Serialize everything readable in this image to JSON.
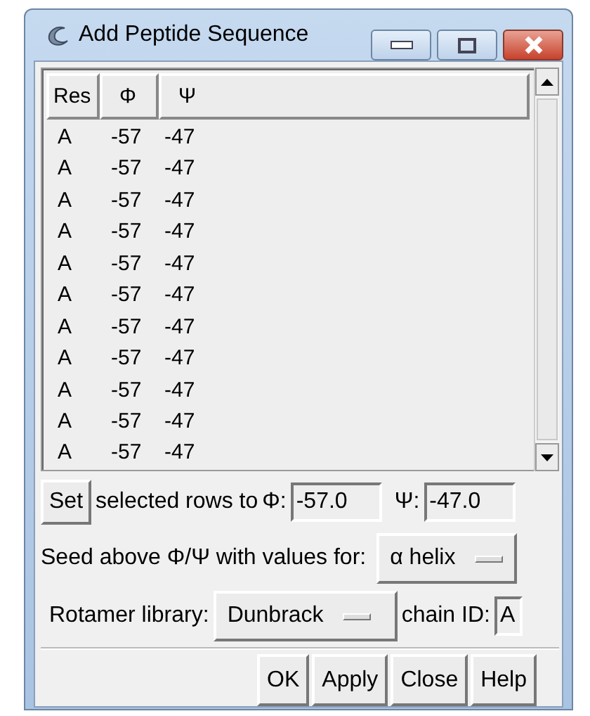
{
  "window": {
    "title": "Add Peptide Sequence"
  },
  "table": {
    "columns": [
      "Res",
      "Φ",
      "Ψ"
    ],
    "rows": [
      {
        "cells": [
          "A",
          "-57",
          "-47"
        ]
      },
      {
        "cells": [
          "A",
          "-57",
          "-47"
        ]
      },
      {
        "cells": [
          "A",
          "-57",
          "-47"
        ]
      },
      {
        "cells": [
          "A",
          "-57",
          "-47"
        ]
      },
      {
        "cells": [
          "A",
          "-57",
          "-47"
        ]
      },
      {
        "cells": [
          "A",
          "-57",
          "-47"
        ]
      },
      {
        "cells": [
          "A",
          "-57",
          "-47"
        ]
      },
      {
        "cells": [
          "A",
          "-57",
          "-47"
        ]
      },
      {
        "cells": [
          "A",
          "-57",
          "-47"
        ]
      },
      {
        "cells": [
          "A",
          "-57",
          "-47"
        ]
      },
      {
        "cells": [
          "A",
          "-57",
          "-47"
        ]
      }
    ]
  },
  "set_row": {
    "button": "Set",
    "label": "selected rows to",
    "phi_label": "Φ:",
    "phi_value": "-57.0",
    "psi_label": "Ψ:",
    "psi_value": "-47.0"
  },
  "seed_row": {
    "label": "Seed above Φ/Ψ with values for:",
    "value": "α helix"
  },
  "rotamer_row": {
    "label": "Rotamer library:",
    "value": "Dunbrack",
    "chain_label": "chain ID:",
    "chain_value": "A"
  },
  "buttons": [
    "OK",
    "Apply",
    "Close",
    "Help"
  ]
}
